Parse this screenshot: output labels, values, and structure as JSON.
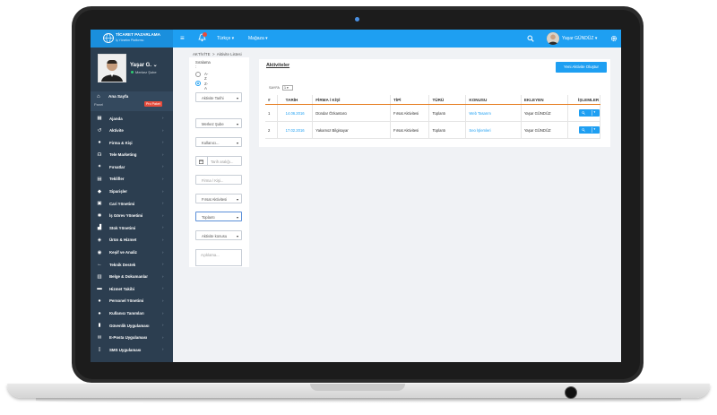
{
  "brand": {
    "name": "TİCARET PAZARLAMA",
    "subtitle": "İş Yönetim Platformu"
  },
  "topbar": {
    "menu_icon": "≡",
    "language": "Türkçe ▾",
    "store": "Mağaza ▾",
    "user_name": "Yaşar GÜNDÜZ ▾",
    "colors": {
      "bar": "#1e9ff2",
      "brand_bg": "#1a8fdd"
    }
  },
  "profile": {
    "name": "Yaşar G. ⌄",
    "branch": "Merkez Şube"
  },
  "sidebar": {
    "home_label": "Ana Sayfa",
    "panel_label": "Panel",
    "pro_badge": "Pro Paket",
    "items": [
      {
        "label": "Ajanda",
        "icon": "calendar-icon",
        "glyph": "▦"
      },
      {
        "label": "Aktivite",
        "icon": "history-icon",
        "glyph": "↺"
      },
      {
        "label": "Firma & Kişi",
        "icon": "user-icon",
        "glyph": "●"
      },
      {
        "label": "Tele Marketing",
        "icon": "headset-icon",
        "glyph": "☊"
      },
      {
        "label": "Fırsatlar",
        "icon": "wand-icon",
        "glyph": "✦"
      },
      {
        "label": "Teklifler",
        "icon": "document-icon",
        "glyph": "▤"
      },
      {
        "label": "Siparişler",
        "icon": "tag-icon",
        "glyph": "◆"
      },
      {
        "label": "Cari Yönetimi",
        "icon": "card-icon",
        "glyph": "▣"
      },
      {
        "label": "İş Görev Yönetimi",
        "icon": "settings-icon",
        "glyph": "✱"
      },
      {
        "label": "Stok Yönetimi",
        "icon": "chart-icon",
        "glyph": "▟"
      },
      {
        "label": "Ürün & Hizmet",
        "icon": "tags-icon",
        "glyph": "◈"
      },
      {
        "label": "Keşif ve Analiz",
        "icon": "eye-icon",
        "glyph": "◉"
      },
      {
        "label": "Teknik Destek",
        "icon": "arrow-icon",
        "glyph": "←"
      },
      {
        "label": "Belge & Dokumanlar",
        "icon": "file-icon",
        "glyph": "▥"
      },
      {
        "label": "Hizmet Takibi",
        "icon": "monitor-icon",
        "glyph": "▬"
      },
      {
        "label": "Personel Yönetimi",
        "icon": "users-icon",
        "glyph": "●"
      },
      {
        "label": "Kullanıcı Tanımları",
        "icon": "group-icon",
        "glyph": "●"
      },
      {
        "label": "Güvenlik Uygulaması",
        "icon": "lock-icon",
        "glyph": "▮"
      },
      {
        "label": "E-Posta Uygulaması",
        "icon": "mail-icon",
        "glyph": "✉"
      },
      {
        "label": "SMS Uygulaması",
        "icon": "phone-icon",
        "glyph": "▯"
      }
    ]
  },
  "breadcrumb": {
    "root": "AKTİVİTE",
    "separator": ">",
    "current": "Aktivite Listesi"
  },
  "filters": {
    "sort_label": "Sıralama :",
    "sort_options": [
      "A-Z",
      "Z-A"
    ],
    "sort_selected": "Z-A",
    "activity_date": "Aktivite Tarihi",
    "branch": "Merkez Şube",
    "user": "Kullanıcı...",
    "date_placeholder": "Tarih aralığı...",
    "company_placeholder": "Firma / Kişi...",
    "opportunity": "Fırsat Aktivitesi",
    "meeting": "Toplantı",
    "activity_subject": "Aktivite konusu",
    "notes_placeholder": "Açıklama..."
  },
  "main": {
    "title": "Aktiviteler",
    "new_button": "Yeni Aktivite Oluştur",
    "page_label": "SAYFA",
    "page_value": "1 ▾",
    "columns": [
      "#",
      "TARİH",
      "FİRMA / KİŞİ",
      "TİPİ",
      "TÜRÜ",
      "KONUSU",
      "EKLEYEN",
      "İŞLEMLER"
    ],
    "rows": [
      {
        "no": "1",
        "date": "14.06.2016",
        "company": "Dündar Özkantarcı",
        "type": "Fırsat Aktivitesi",
        "kind": "Toplantı",
        "subject": "Web Tasarım",
        "added_by": "Yaşar GÜNDÜZ"
      },
      {
        "no": "2",
        "date": "17.02.2016",
        "company": "Yakamoz Bilgisayar",
        "type": "Fırsat Aktivitesi",
        "kind": "Toplantı",
        "subject": "Seo İşlemleri",
        "added_by": "Yaşar GÜNDÜZ"
      }
    ]
  }
}
